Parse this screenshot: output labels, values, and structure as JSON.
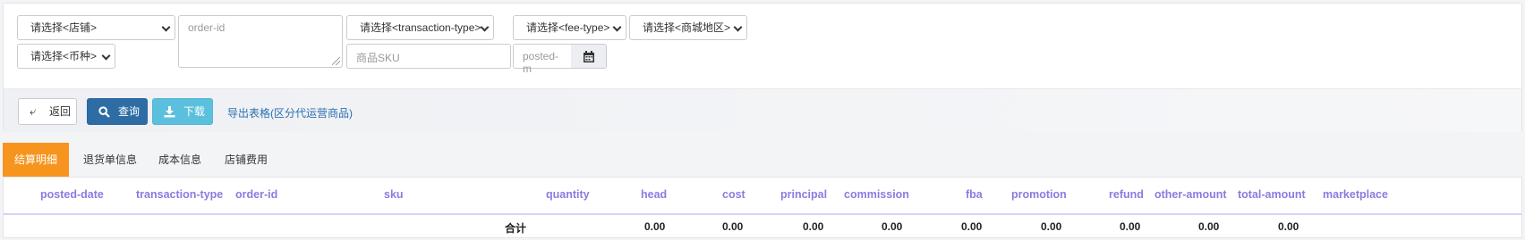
{
  "filters": {
    "store_select": "请选择<店铺>",
    "order_id_placeholder": "order-id",
    "transaction_type_select": "请选择<transaction-type>",
    "fee_type_select": "请选择<fee-type>",
    "marketplace_select": "请选择<商城地区>",
    "currency_select": "请选择<币种>",
    "sku_placeholder": "商品SKU",
    "posted_date_placeholder": "posted-m"
  },
  "toolbar": {
    "back_label": "返回",
    "query_label": "查询",
    "download_label": "下载",
    "export_link": "导出表格(区分代运营商品)"
  },
  "tabs": [
    "结算明细",
    "退货单信息",
    "成本信息",
    "店铺费用"
  ],
  "active_tab": 0,
  "table": {
    "columns": [
      "posted-date",
      "transaction-type",
      "order-id",
      "sku",
      "quantity",
      "head",
      "cost",
      "principal",
      "commission",
      "fba",
      "promotion",
      "refund",
      "other-amount",
      "total-amount",
      "marketplace"
    ],
    "total_row": {
      "label": "合计",
      "head": "0.00",
      "cost": "0.00",
      "principal": "0.00",
      "commission": "0.00",
      "fba": "0.00",
      "promotion": "0.00",
      "refund": "0.00",
      "other_amount": "0.00",
      "total_amount": "0.00"
    }
  },
  "colors": {
    "active_tab": "#f7941d",
    "header_text": "#8a7ce0",
    "primary_button": "#2e6da4",
    "info_button": "#5bc0de",
    "link": "#2a6fb3"
  }
}
